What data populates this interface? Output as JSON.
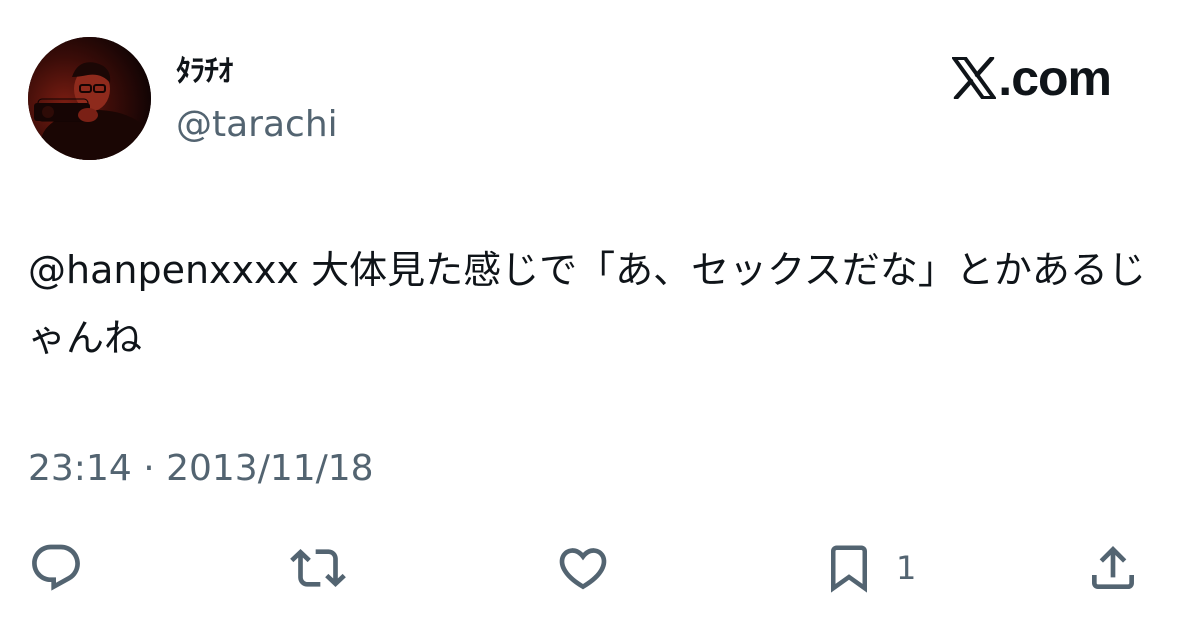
{
  "author": {
    "display_name": "ﾀﾗﾁｵ",
    "handle": "@tarachi",
    "avatar_icon": "user-avatar-photo"
  },
  "brand": {
    "text": ".com",
    "icon": "x-logo-icon"
  },
  "tweet": {
    "text": "@hanpenxxxx 大体見た感じで「あ、セックスだな」とかあるじゃんね",
    "timestamp": "23:14 · 2013/11/18"
  },
  "actions": {
    "reply": {
      "icon": "reply-icon",
      "count": ""
    },
    "retweet": {
      "icon": "retweet-icon",
      "count": ""
    },
    "like": {
      "icon": "heart-icon",
      "count": ""
    },
    "bookmark": {
      "icon": "bookmark-icon",
      "count": "1"
    },
    "share": {
      "icon": "share-icon",
      "count": ""
    }
  },
  "colors": {
    "text_primary": "#0f1419",
    "text_secondary": "#536471",
    "background": "#ffffff"
  }
}
